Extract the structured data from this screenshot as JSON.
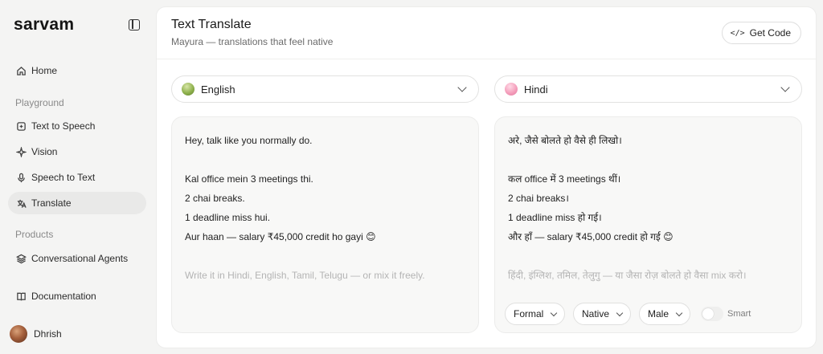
{
  "sidebar": {
    "logo": "sarvam",
    "home": "Home",
    "section_playground": "Playground",
    "playground_items": [
      "Text to Speech",
      "Vision",
      "Speech to Text",
      "Translate"
    ],
    "section_products": "Products",
    "products_items": [
      "Conversational Agents"
    ],
    "documentation": "Documentation",
    "user_name": "Dhrish"
  },
  "header": {
    "title": "Text Translate",
    "subtitle": "Mayura — translations that feel native",
    "get_code": "Get Code"
  },
  "source": {
    "language": "English",
    "lines": [
      "Hey, talk like you normally do.",
      "Kal office mein 3 meetings thi.",
      "2 chai breaks.",
      "1 deadline miss hui.",
      "Aur haan — salary ₹45,000 credit ho gayi 😊"
    ],
    "placeholder": "Write it in Hindi, English, Tamil, Telugu — or mix it freely."
  },
  "target": {
    "language": "Hindi",
    "lines": [
      "अरे, जैसे बोलते हो वैसे ही लिखो।",
      "कल office में 3 meetings थीं।",
      "2 chai breaks।",
      "1 deadline miss हो गई।",
      "और हाँ — salary ₹45,000 credit हो गई 😊"
    ],
    "placeholder": "हिंदी, इंग्लिश, तमिल, तेलुगु — या जैसा रोज़ बोलते हो वैसा mix करो।"
  },
  "options": {
    "formality": "Formal",
    "style": "Native",
    "gender": "Male",
    "smart_label": "Smart",
    "smart_enabled": false
  },
  "colors": {
    "accent_english_dot": "#8fb14d",
    "accent_hindi_dot": "#f39ab8",
    "active_nav_bg": "#e9e9e8"
  },
  "icons": {
    "home": "home-icon",
    "tts": "text-to-speech-icon",
    "vision": "sparkle-icon",
    "stt": "microphone-icon",
    "translate": "translate-icon",
    "agents": "layers-icon",
    "docs": "book-icon",
    "code": "code-icon"
  }
}
